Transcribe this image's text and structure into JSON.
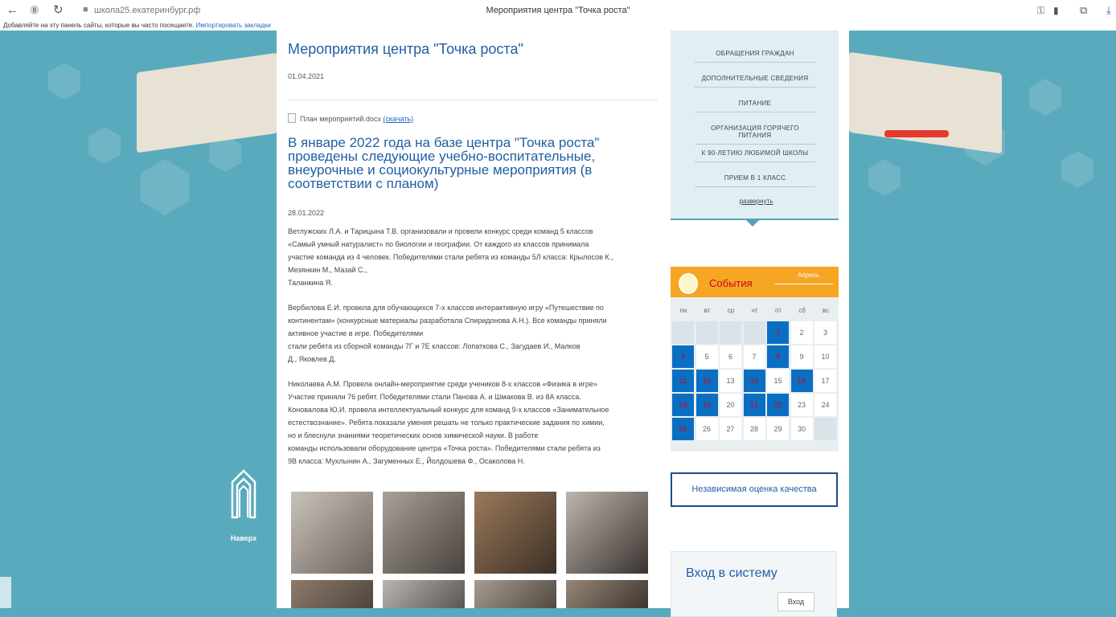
{
  "browser": {
    "url": "школа25.екатеринбург.рф",
    "tab_title": "Мероприятия центра \"Точка роста\"",
    "bookmarks_text": "Добавляйте на эту панель сайты, которые вы часто посещаете.",
    "bookmarks_link": "Импортировать закладки",
    "icons": [
      "back-icon",
      "reader-icon",
      "reload-icon",
      "lock-icon",
      "key-icon",
      "bookmark-icon",
      "collections-icon",
      "download-icon"
    ]
  },
  "article": {
    "title": "Мероприятия центра \"Точка роста\"",
    "date": "01.04.2021",
    "attachment_name": "План мероприятий.docx",
    "attachment_link": "(скачать)",
    "subtitle": "В январе 2022 года на базе центра \"Точка роста\" проведены следующие учебно-воспитательные, внеурочные и социокультурные мероприятия (в соответствии с планом)",
    "sub_date": "28.01.2022",
    "paragraphs": [
      "Ветлужских Л.А. и Тарицына Т.В. организовали и провели конкурс среди команд 5 классов\n«Самый умный натуралист» по биологии и географии. От каждого из классов принимала\nучастие команда из 4 человек. Победителями стали ребята из команды 5Л класса: Крылосов К.,\nМезянкин М., Мазай С.,\nТаланкина Я.",
      "Вербилова Е.И. провела для обучающихся 7-х классов интерактивную игру «Путешествие по\nконтинентам» (конкурсные материалы разработала Спиридонова А.Н.). Все команды приняли\nактивное участие в игре. Победителями\nстали ребята из сборной команды 7Г и 7Е классов: Лопаткова С., Загудаев И., Малков\nД., Яковлев Д.",
      "Николаева А.М. Провела онлайн-мероприятие среди учеников 8-х классов «Физика в игре»\nУчастие приняли 76 ребят. Победителями стали Панова А. и Шмакова В. из 8А класса.\nКоновалова Ю.И. провела интеллектуальный конкурс для команд 9-х классов «Занимательное\nестествознание». Ребята показали умения решать не только практические задания по химии,\nно и блеснули знаниями теоретических основ химической науки. В работе\nкоманды использовали оборудование центра «Точка роста». Победителями стали ребята из\n9В класса: Мухлынин А., Загуменных Е., Йолдошева Ф., Осаколова Н."
    ]
  },
  "sidebar": {
    "menu": [
      "ОБРАЩЕНИЯ ГРАЖДАН",
      "ДОПОЛНИТЕЛЬНЫЕ СВЕДЕНИЯ",
      "ПИТАНИЕ",
      "ОРГАНИЗАЦИЯ ГОРЯЧЕГО ПИТАНИЯ",
      "К 90-ЛЕТИЮ ЛЮБИМОЙ ШКОЛЫ",
      "ПРИЕМ В 1 КЛАСС"
    ],
    "expand": "развернуть",
    "calendar": {
      "title": "События",
      "month": "Апрель",
      "weekdays": [
        "пн",
        "вт",
        "ср",
        "чт",
        "пт",
        "сб",
        "вс"
      ],
      "days": [
        "",
        "",
        "",
        "",
        "1",
        "2",
        "3",
        "4",
        "5",
        "6",
        "7",
        "8",
        "9",
        "10",
        "11",
        "12",
        "13",
        "14",
        "15",
        "16",
        "17",
        "18",
        "19",
        "20",
        "21",
        "22",
        "23",
        "24",
        "25",
        "26",
        "27",
        "28",
        "29",
        "30",
        ""
      ],
      "event_days": [
        "1",
        "4",
        "8",
        "11",
        "12",
        "14",
        "16",
        "18",
        "19",
        "21",
        "22",
        "25"
      ]
    },
    "independent": "Независимая оценка качества",
    "login_title": "Вход в систему",
    "login_button": "Вход"
  },
  "to_top": "Наверх",
  "colors": {
    "background": "#5aaabe",
    "link": "#1f5fa3",
    "calendar_header": "#f5a623",
    "event_day": "#0a6fc2"
  }
}
